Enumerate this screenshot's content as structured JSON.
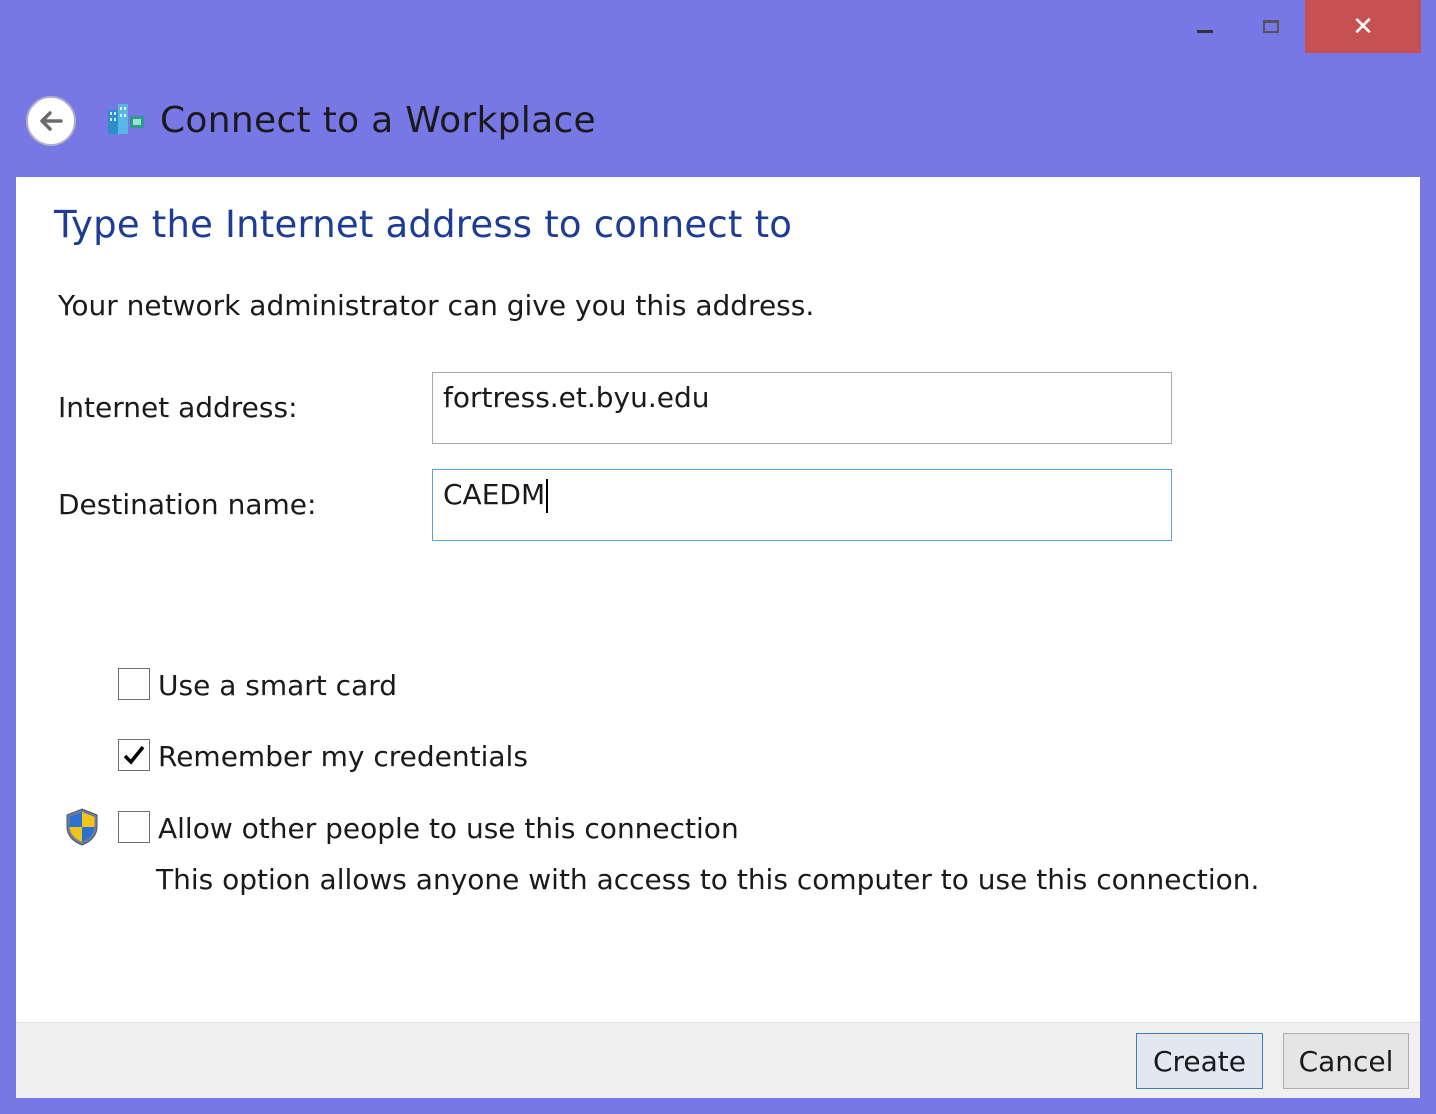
{
  "window": {
    "title": "Connect to a Workplace",
    "caption_buttons": {
      "minimize": "minimize",
      "maximize": "maximize",
      "close": "close"
    },
    "close_symbol": "✕"
  },
  "page": {
    "heading": "Type the Internet address to connect to",
    "intro": "Your network administrator can give you this address."
  },
  "fields": {
    "internet_address": {
      "label": "Internet address:",
      "value": "fortress.et.byu.edu"
    },
    "destination_name": {
      "label": "Destination name:",
      "value": "CAEDM"
    }
  },
  "options": {
    "smart_card": {
      "label": "Use a smart card",
      "checked": false
    },
    "remember_credentials": {
      "label": "Remember my credentials",
      "checked": true
    },
    "allow_others": {
      "label": "Allow other people to use this connection",
      "checked": false,
      "note": "This option allows anyone with access to this computer to use this connection."
    }
  },
  "buttons": {
    "create": "Create",
    "cancel": "Cancel"
  },
  "colors": {
    "frame": "#7877e6",
    "close_button": "#c75050",
    "heading": "#1e3c96",
    "focus_border": "#5aa1d4"
  },
  "icons": {
    "back": "back-arrow-icon",
    "app": "workplace-network-icon",
    "shield": "uac-shield-icon",
    "check": "checkmark-icon"
  }
}
